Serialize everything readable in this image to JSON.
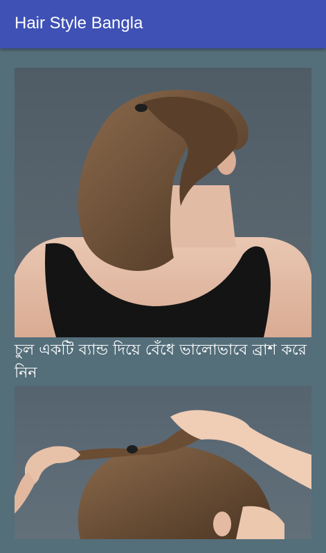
{
  "app_bar": {
    "title": "Hair Style Bangla",
    "background_color": "#3f51b5"
  },
  "screen": {
    "background_color": "#546e7a"
  },
  "feed": {
    "items": [
      {
        "image": "woman-ponytail-back-view-photo",
        "caption": "চুল একটি ব্যান্ড দিয়ে বেঁধে ভালোভাবে ব্রাশ করে নিন"
      },
      {
        "image": "hands-twisting-ponytail-photo"
      }
    ]
  }
}
